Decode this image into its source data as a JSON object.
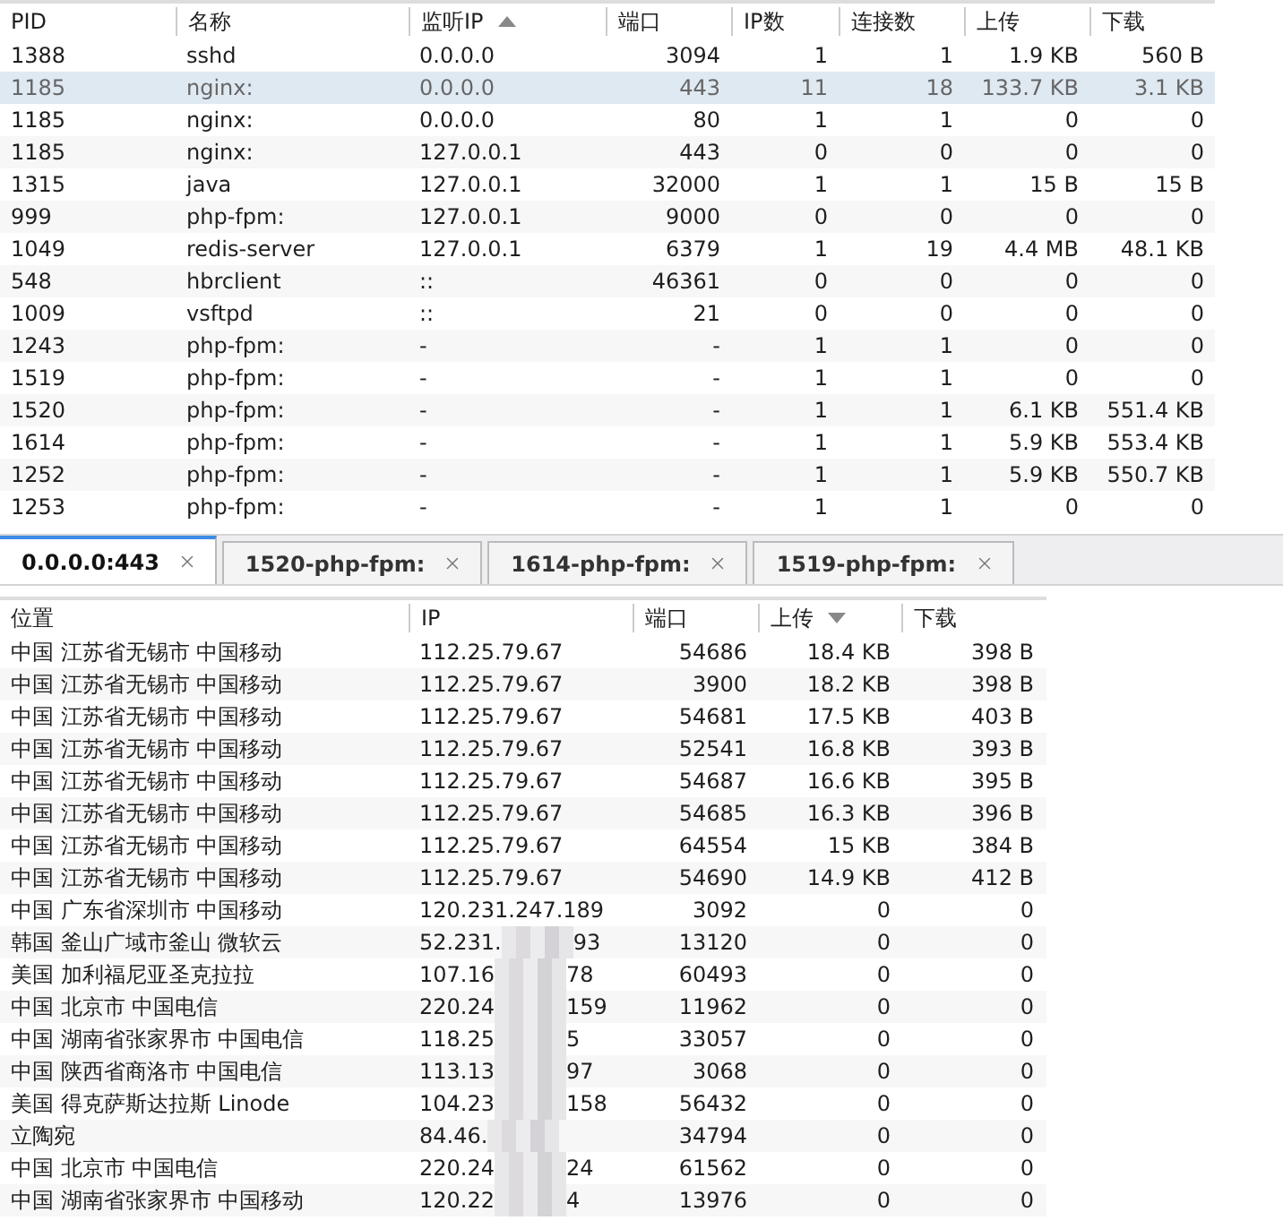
{
  "process_table": {
    "columns": [
      {
        "label": "PID"
      },
      {
        "label": "名称"
      },
      {
        "label": "监听IP",
        "sorted": true,
        "sort_ascending": true
      },
      {
        "label": "端口"
      },
      {
        "label": "IP数"
      },
      {
        "label": "连接数"
      },
      {
        "label": "上传"
      },
      {
        "label": "下载"
      }
    ],
    "rows": [
      {
        "selected": false,
        "cells": [
          "1388",
          "sshd",
          "0.0.0.0",
          "3094",
          "1",
          "1",
          "1.9 KB",
          "560 B"
        ]
      },
      {
        "selected": true,
        "cells": [
          "1185",
          "nginx:",
          "0.0.0.0",
          "443",
          "11",
          "18",
          "133.7 KB",
          "3.1 KB"
        ]
      },
      {
        "selected": false,
        "cells": [
          "1185",
          "nginx:",
          "0.0.0.0",
          "80",
          "1",
          "1",
          "0",
          "0"
        ]
      },
      {
        "selected": false,
        "cells": [
          "1185",
          "nginx:",
          "127.0.0.1",
          "443",
          "0",
          "0",
          "0",
          "0"
        ]
      },
      {
        "selected": false,
        "cells": [
          "1315",
          "java",
          "127.0.0.1",
          "32000",
          "1",
          "1",
          "15 B",
          "15 B"
        ]
      },
      {
        "selected": false,
        "cells": [
          "999",
          "php-fpm:",
          "127.0.0.1",
          "9000",
          "0",
          "0",
          "0",
          "0"
        ]
      },
      {
        "selected": false,
        "cells": [
          "1049",
          "redis-server",
          "127.0.0.1",
          "6379",
          "1",
          "19",
          "4.4 MB",
          "48.1 KB"
        ]
      },
      {
        "selected": false,
        "cells": [
          "548",
          "hbrclient",
          "::",
          "46361",
          "0",
          "0",
          "0",
          "0"
        ]
      },
      {
        "selected": false,
        "cells": [
          "1009",
          "vsftpd",
          "::",
          "21",
          "0",
          "0",
          "0",
          "0"
        ]
      },
      {
        "selected": false,
        "cells": [
          "1243",
          "php-fpm:",
          "-",
          "-",
          "1",
          "1",
          "0",
          "0"
        ]
      },
      {
        "selected": false,
        "cells": [
          "1519",
          "php-fpm:",
          "-",
          "-",
          "1",
          "1",
          "0",
          "0"
        ]
      },
      {
        "selected": false,
        "cells": [
          "1520",
          "php-fpm:",
          "-",
          "-",
          "1",
          "1",
          "6.1 KB",
          "551.4 KB"
        ]
      },
      {
        "selected": false,
        "cells": [
          "1614",
          "php-fpm:",
          "-",
          "-",
          "1",
          "1",
          "5.9 KB",
          "553.4 KB"
        ]
      },
      {
        "selected": false,
        "cells": [
          "1252",
          "php-fpm:",
          "-",
          "-",
          "1",
          "1",
          "5.9 KB",
          "550.7 KB"
        ]
      },
      {
        "selected": false,
        "cells": [
          "1253",
          "php-fpm:",
          "-",
          "-",
          "1",
          "1",
          "0",
          "0"
        ]
      }
    ]
  },
  "tabs": [
    {
      "label": "0.0.0.0:443",
      "selected": true
    },
    {
      "label": "1520-php-fpm:",
      "selected": false
    },
    {
      "label": "1614-php-fpm:",
      "selected": false
    },
    {
      "label": "1519-php-fpm:",
      "selected": false
    }
  ],
  "connection_table": {
    "columns": [
      {
        "label": "位置"
      },
      {
        "label": "IP"
      },
      {
        "label": "端口"
      },
      {
        "label": "上传",
        "sorted": true,
        "sort_ascending": false
      },
      {
        "label": "下载"
      }
    ],
    "rows": [
      {
        "location": "中国 江苏省无锡市 中国移动",
        "ip": "112.25.79.67",
        "port": "54686",
        "upload": "18.4 KB",
        "download": "398 B"
      },
      {
        "location": "中国 江苏省无锡市 中国移动",
        "ip": "112.25.79.67",
        "port": "3900",
        "upload": "18.2 KB",
        "download": "398 B"
      },
      {
        "location": "中国 江苏省无锡市 中国移动",
        "ip": "112.25.79.67",
        "port": "54681",
        "upload": "17.5 KB",
        "download": "403 B"
      },
      {
        "location": "中国 江苏省无锡市 中国移动",
        "ip": "112.25.79.67",
        "port": "52541",
        "upload": "16.8 KB",
        "download": "393 B"
      },
      {
        "location": "中国 江苏省无锡市 中国移动",
        "ip": "112.25.79.67",
        "port": "54687",
        "upload": "16.6 KB",
        "download": "395 B"
      },
      {
        "location": "中国 江苏省无锡市 中国移动",
        "ip": "112.25.79.67",
        "port": "54685",
        "upload": "16.3 KB",
        "download": "396 B"
      },
      {
        "location": "中国 江苏省无锡市 中国移动",
        "ip": "112.25.79.67",
        "port": "64554",
        "upload": "15 KB",
        "download": "384 B"
      },
      {
        "location": "中国 江苏省无锡市 中国移动",
        "ip": "112.25.79.67",
        "port": "54690",
        "upload": "14.9 KB",
        "download": "412 B"
      },
      {
        "location": "中国 广东省深圳市 中国移动",
        "ip": "120.231.247.189",
        "port": "3092",
        "upload": "0",
        "download": "0"
      },
      {
        "location": "韩国 釜山广域市釜山 微软云",
        "ip": "52.231.",
        "ip_tail": "93",
        "blurred": true,
        "port": "13120",
        "upload": "0",
        "download": "0"
      },
      {
        "location": "美国 加利福尼亚圣克拉拉",
        "ip": "107.16",
        "ip_tail": "78",
        "blurred": true,
        "port": "60493",
        "upload": "0",
        "download": "0"
      },
      {
        "location": "中国 北京市 中国电信",
        "ip": "220.24",
        "ip_tail": "159",
        "blurred": true,
        "port": "11962",
        "upload": "0",
        "download": "0"
      },
      {
        "location": "中国 湖南省张家界市 中国电信",
        "ip": "118.25",
        "ip_tail": "5",
        "blurred": true,
        "port": "33057",
        "upload": "0",
        "download": "0"
      },
      {
        "location": "中国 陕西省商洛市 中国电信",
        "ip": "113.13",
        "ip_tail": "97",
        "blurred": true,
        "port": "3068",
        "upload": "0",
        "download": "0"
      },
      {
        "location": "美国 得克萨斯达拉斯 Linode",
        "ip": "104.23",
        "ip_tail": "158",
        "blurred": true,
        "port": "56432",
        "upload": "0",
        "download": "0"
      },
      {
        "location": "立陶宛",
        "ip": "84.46.",
        "blurred": true,
        "port": "34794",
        "upload": "0",
        "download": "0"
      },
      {
        "location": "中国 北京市 中国电信",
        "ip": "220.24",
        "ip_tail": "24",
        "blurred": true,
        "port": "61562",
        "upload": "0",
        "download": "0"
      },
      {
        "location": "中国 湖南省张家界市 中国移动",
        "ip": "120.22",
        "ip_tail": "4",
        "blurred": true,
        "port": "13976",
        "upload": "0",
        "download": "0"
      }
    ]
  }
}
